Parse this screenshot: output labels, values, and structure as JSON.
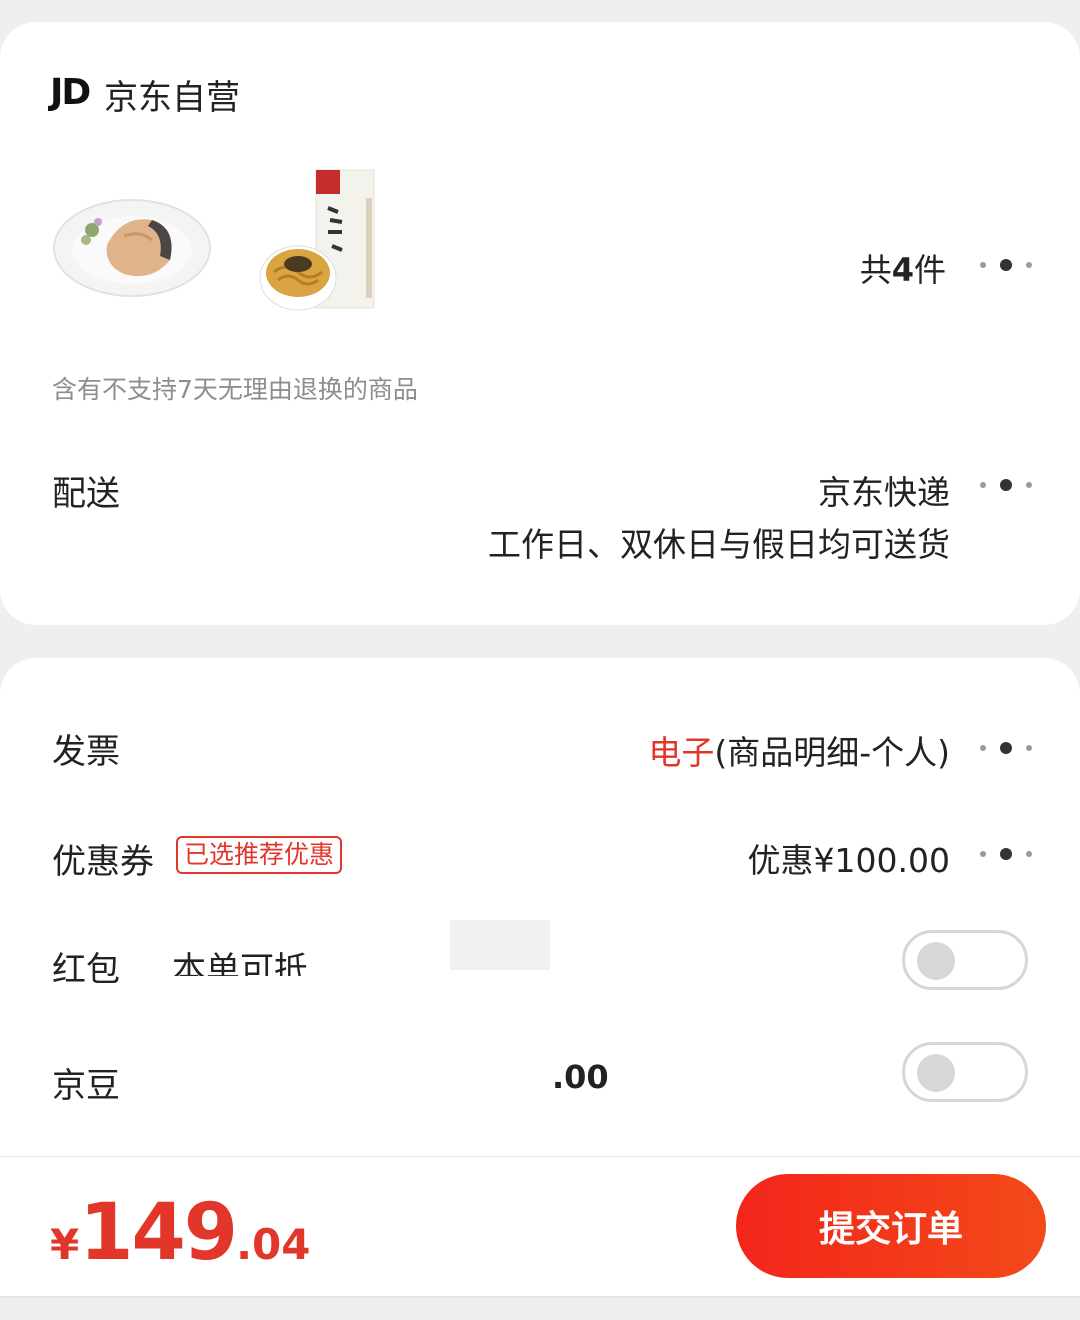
{
  "store": {
    "logo_text": "JD",
    "name": "京东自营"
  },
  "products": {
    "item_count_prefix": "共",
    "item_count": "4",
    "item_count_suffix": "件",
    "product_2_label": "酱油拌面"
  },
  "return_notice": "含有不支持7天无理由退换的商品",
  "delivery": {
    "label": "配送",
    "method": "京东快递",
    "schedule": "工作日、双休日与假日均可送货"
  },
  "invoice": {
    "label": "发票",
    "type_highlight": "电子",
    "detail": "(商品明细-个人)"
  },
  "coupon": {
    "label": "优惠券",
    "badge": "已选推荐优惠",
    "value": "优惠¥100.00"
  },
  "red_packet": {
    "label": "红包",
    "desc_partial": "本单可抵"
  },
  "jingdou": {
    "label": "京豆",
    "value_partial": ".00"
  },
  "footer": {
    "currency": "¥",
    "price_int": "149",
    "price_dec": ".04",
    "submit_label": "提交订单"
  },
  "colors": {
    "accent": "#e3362a"
  }
}
